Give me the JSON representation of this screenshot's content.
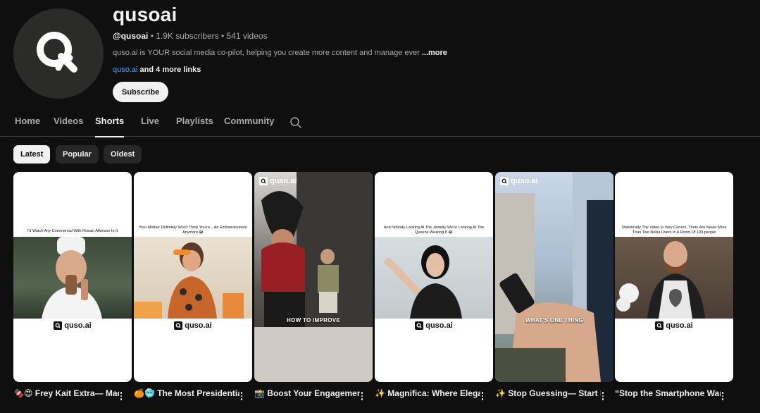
{
  "channel": {
    "name": "qusoai",
    "handle": "@qusoai",
    "subscribers": "1.9K subscribers",
    "videos": "541 videos",
    "description": "quso.ai is YOUR social media co-pilot, helping you create more content and manage ever",
    "more_label": "...more",
    "primary_link": "quso.ai",
    "more_links": "and 4 more links",
    "subscribe_label": "Subscribe"
  },
  "tabs": [
    {
      "label": "Home"
    },
    {
      "label": "Videos"
    },
    {
      "label": "Shorts",
      "active": true
    },
    {
      "label": "Live"
    },
    {
      "label": "Playlists"
    },
    {
      "label": "Community"
    }
  ],
  "filters": [
    {
      "label": "Latest",
      "selected": true
    },
    {
      "label": "Popular"
    },
    {
      "label": "Oldest"
    }
  ],
  "shorts": [
    {
      "thumb_caption": "I'd Watch Any Commercial With Rowan Atkinson In It",
      "brand": "quso.ai",
      "title": "🍫😍 Frey Kait Extra— Made with Extra ..."
    },
    {
      "thumb_caption": "Your Mother Definitely Won't Think You're... An Embarrassment Anymore 😂",
      "brand": "quso.ai",
      "title": "🍊🥶 The Most Presidential Orange ..."
    },
    {
      "overlay": "HOW TO IMPROVE",
      "brand": "quso.ai",
      "title": "📸 Boost Your Engagement with ..."
    },
    {
      "thumb_caption": "And Nobody Looking At The Jewelry We're Looking At The Queens Wearing It 😂",
      "brand": "quso.ai",
      "title": "✨ Magnifica: Where Elegance Meets Powe..."
    },
    {
      "overlay": "WHAT'S ONE THING",
      "brand": "quso.ai",
      "title": "✨ Stop Guessing— Start Posting with ..."
    },
    {
      "thumb_caption": "Statistically The Video Is Very Correct, There Are Never More Than Two Nokia Users In A Room Of 100 people",
      "brand": "quso.ai",
      "title": "“Stop the Smartphone Wars” – Nokia Lumia ..."
    }
  ],
  "colors": {
    "background": "#0f0f0f",
    "text_primary": "#f1f1f1",
    "text_secondary": "#aaaaaa",
    "link": "#3ea6ff",
    "chip_bg": "#272727"
  }
}
